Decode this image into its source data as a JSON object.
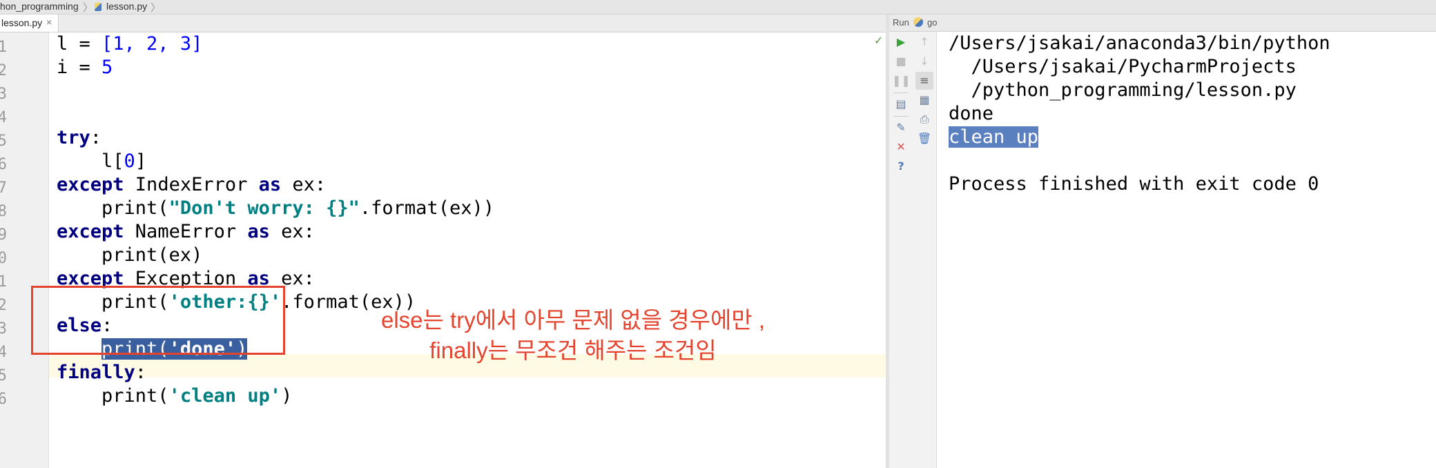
{
  "breadcrumb": {
    "project": "hon_programming",
    "file": "lesson.py"
  },
  "editor_tab": {
    "label": "lesson.py",
    "close": "×"
  },
  "line_numbers": [
    "1",
    "2",
    "3",
    "4",
    "5",
    "6",
    "7",
    "8",
    "9",
    "0",
    "1",
    "2",
    "3",
    "4",
    "5",
    "6"
  ],
  "code": [
    [
      "l = ",
      "[1, 2, 3]"
    ],
    [
      "i = ",
      "5"
    ],
    [],
    [
      "try",
      ":"
    ],
    [
      "    l[",
      "0",
      "]"
    ],
    [
      "except",
      " IndexError ",
      "as",
      " ex:"
    ],
    [
      "    print(",
      "\"Don't worry: {}\"",
      ".format(ex))"
    ],
    [
      "except",
      " NameError ",
      "as",
      " ex:"
    ],
    [
      "    print(ex)"
    ],
    [
      "except",
      " Exception ",
      "as",
      " ex:"
    ],
    [
      "    print(",
      "'other:{}'",
      ".format(ex))"
    ],
    [
      "else",
      ":"
    ],
    [
      "    ",
      "print(",
      "'done'",
      ")"
    ],
    [
      "finally",
      ":"
    ],
    [
      "    print(",
      "'clean up'",
      ")"
    ],
    []
  ],
  "annotation": {
    "line1": "else는 try에서 아무 문제 없을 경우에만 ,",
    "line2": "finally는 무조건 해주는 조건임",
    "color": "#e4442e"
  },
  "run_panel": {
    "title": "Run",
    "config": "go",
    "output": [
      "/Users/jsakai/anaconda3/bin/python",
      "  /Users/jsakai/PycharmProjects",
      "  /python_programming/lesson.py",
      "done",
      "clean up",
      "",
      "Process finished with exit code 0"
    ],
    "selected_output": "clean up"
  },
  "colors": {
    "keyword": "#000080",
    "number": "#0000ff",
    "string": "#008080",
    "selection": "#3a5f9f"
  },
  "icons": [
    "run-icon",
    "stop-icon",
    "pause-icon",
    "up-arrow-icon",
    "down-arrow-icon",
    "soft-wrap-icon",
    "print-icon",
    "pin-icon",
    "close-icon",
    "help-icon",
    "trash-icon",
    "layout-icon",
    "scroll-icon"
  ]
}
